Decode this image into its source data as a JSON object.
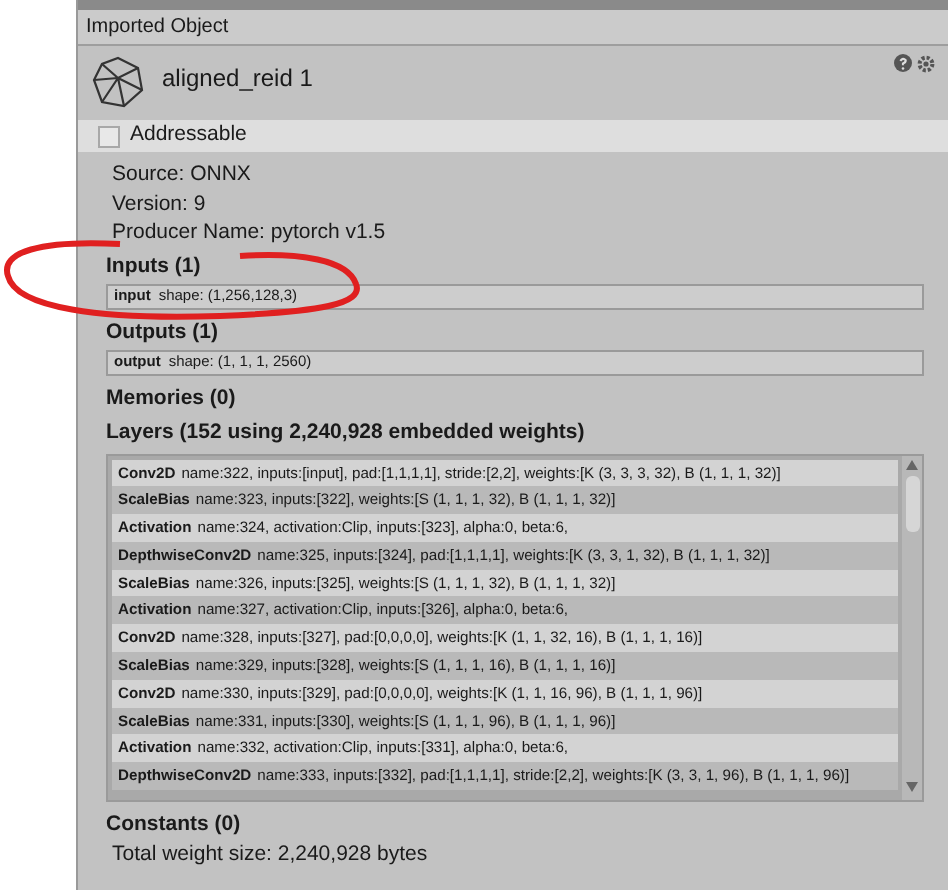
{
  "panel_title": "Imported Object",
  "object": {
    "name": "aligned_reid 1"
  },
  "addressable": {
    "label": "Addressable",
    "checked": false
  },
  "info": [
    "Source: ONNX",
    "Version: 9",
    "Producer Name: pytorch v1.5"
  ],
  "inputs": {
    "heading": "Inputs (1)",
    "items": [
      {
        "name": "input",
        "shape": "shape: (1,256,128,3)"
      }
    ]
  },
  "outputs": {
    "heading": "Outputs (1)",
    "items": [
      {
        "name": "output",
        "shape": "shape: (1, 1, 1, 2560)"
      }
    ]
  },
  "memories": {
    "heading": "Memories (0)"
  },
  "layers": {
    "heading": "Layers (152 using 2,240,928 embedded weights)",
    "rows": [
      {
        "type": "Conv2D",
        "details": "name:322, inputs:[input], pad:[1,1,1,1], stride:[2,2], weights:[K (3, 3, 3, 32), B (1, 1, 1, 32)]"
      },
      {
        "type": "ScaleBias",
        "details": "name:323, inputs:[322], weights:[S (1, 1, 1, 32), B (1, 1, 1, 32)]"
      },
      {
        "type": "Activation",
        "details": "name:324, activation:Clip, inputs:[323], alpha:0, beta:6,"
      },
      {
        "type": "DepthwiseConv2D",
        "details": "name:325, inputs:[324], pad:[1,1,1,1], weights:[K (3, 3, 1, 32), B (1, 1, 1, 32)]"
      },
      {
        "type": "ScaleBias",
        "details": "name:326, inputs:[325], weights:[S (1, 1, 1, 32), B (1, 1, 1, 32)]"
      },
      {
        "type": "Activation",
        "details": "name:327, activation:Clip, inputs:[326], alpha:0, beta:6,"
      },
      {
        "type": "Conv2D",
        "details": "name:328, inputs:[327], pad:[0,0,0,0], weights:[K (1, 1, 32, 16), B (1, 1, 1, 16)]"
      },
      {
        "type": "ScaleBias",
        "details": "name:329, inputs:[328], weights:[S (1, 1, 1, 16), B (1, 1, 1, 16)]"
      },
      {
        "type": "Conv2D",
        "details": "name:330, inputs:[329], pad:[0,0,0,0], weights:[K (1, 1, 16, 96), B (1, 1, 1, 96)]"
      },
      {
        "type": "ScaleBias",
        "details": "name:331, inputs:[330], weights:[S (1, 1, 1, 96), B (1, 1, 1, 96)]"
      },
      {
        "type": "Activation",
        "details": "name:332, activation:Clip, inputs:[331], alpha:0, beta:6,"
      },
      {
        "type": "DepthwiseConv2D",
        "details": "name:333, inputs:[332], pad:[1,1,1,1], stride:[2,2], weights:[K (3, 3, 1, 96), B (1, 1, 1, 96)]"
      }
    ]
  },
  "constants": {
    "heading": "Constants (0)"
  },
  "total": "Total weight size: 2,240,928 bytes"
}
